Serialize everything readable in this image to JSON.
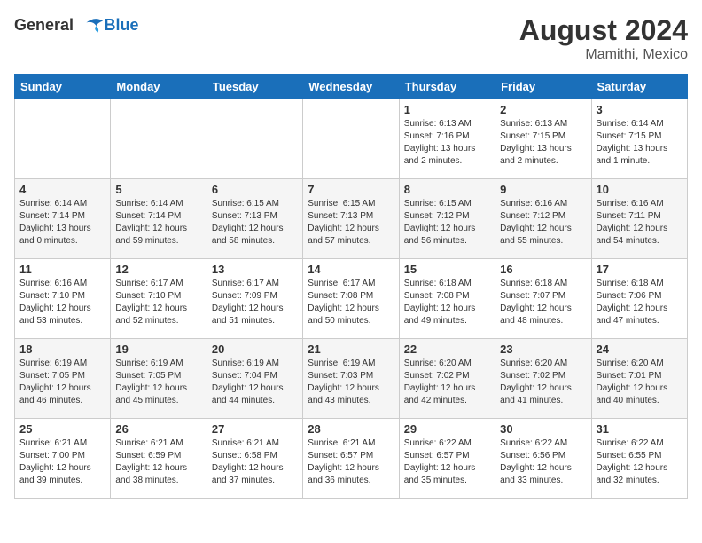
{
  "header": {
    "logo_general": "General",
    "logo_blue": "Blue",
    "month_year": "August 2024",
    "location": "Mamithi, Mexico"
  },
  "days_of_week": [
    "Sunday",
    "Monday",
    "Tuesday",
    "Wednesday",
    "Thursday",
    "Friday",
    "Saturday"
  ],
  "weeks": [
    [
      {
        "day": "",
        "sunrise": "",
        "sunset": "",
        "daylight": ""
      },
      {
        "day": "",
        "sunrise": "",
        "sunset": "",
        "daylight": ""
      },
      {
        "day": "",
        "sunrise": "",
        "sunset": "",
        "daylight": ""
      },
      {
        "day": "",
        "sunrise": "",
        "sunset": "",
        "daylight": ""
      },
      {
        "day": "1",
        "sunrise": "Sunrise: 6:13 AM",
        "sunset": "Sunset: 7:16 PM",
        "daylight": "Daylight: 13 hours and 2 minutes."
      },
      {
        "day": "2",
        "sunrise": "Sunrise: 6:13 AM",
        "sunset": "Sunset: 7:15 PM",
        "daylight": "Daylight: 13 hours and 2 minutes."
      },
      {
        "day": "3",
        "sunrise": "Sunrise: 6:14 AM",
        "sunset": "Sunset: 7:15 PM",
        "daylight": "Daylight: 13 hours and 1 minute."
      }
    ],
    [
      {
        "day": "4",
        "sunrise": "Sunrise: 6:14 AM",
        "sunset": "Sunset: 7:14 PM",
        "daylight": "Daylight: 13 hours and 0 minutes."
      },
      {
        "day": "5",
        "sunrise": "Sunrise: 6:14 AM",
        "sunset": "Sunset: 7:14 PM",
        "daylight": "Daylight: 12 hours and 59 minutes."
      },
      {
        "day": "6",
        "sunrise": "Sunrise: 6:15 AM",
        "sunset": "Sunset: 7:13 PM",
        "daylight": "Daylight: 12 hours and 58 minutes."
      },
      {
        "day": "7",
        "sunrise": "Sunrise: 6:15 AM",
        "sunset": "Sunset: 7:13 PM",
        "daylight": "Daylight: 12 hours and 57 minutes."
      },
      {
        "day": "8",
        "sunrise": "Sunrise: 6:15 AM",
        "sunset": "Sunset: 7:12 PM",
        "daylight": "Daylight: 12 hours and 56 minutes."
      },
      {
        "day": "9",
        "sunrise": "Sunrise: 6:16 AM",
        "sunset": "Sunset: 7:12 PM",
        "daylight": "Daylight: 12 hours and 55 minutes."
      },
      {
        "day": "10",
        "sunrise": "Sunrise: 6:16 AM",
        "sunset": "Sunset: 7:11 PM",
        "daylight": "Daylight: 12 hours and 54 minutes."
      }
    ],
    [
      {
        "day": "11",
        "sunrise": "Sunrise: 6:16 AM",
        "sunset": "Sunset: 7:10 PM",
        "daylight": "Daylight: 12 hours and 53 minutes."
      },
      {
        "day": "12",
        "sunrise": "Sunrise: 6:17 AM",
        "sunset": "Sunset: 7:10 PM",
        "daylight": "Daylight: 12 hours and 52 minutes."
      },
      {
        "day": "13",
        "sunrise": "Sunrise: 6:17 AM",
        "sunset": "Sunset: 7:09 PM",
        "daylight": "Daylight: 12 hours and 51 minutes."
      },
      {
        "day": "14",
        "sunrise": "Sunrise: 6:17 AM",
        "sunset": "Sunset: 7:08 PM",
        "daylight": "Daylight: 12 hours and 50 minutes."
      },
      {
        "day": "15",
        "sunrise": "Sunrise: 6:18 AM",
        "sunset": "Sunset: 7:08 PM",
        "daylight": "Daylight: 12 hours and 49 minutes."
      },
      {
        "day": "16",
        "sunrise": "Sunrise: 6:18 AM",
        "sunset": "Sunset: 7:07 PM",
        "daylight": "Daylight: 12 hours and 48 minutes."
      },
      {
        "day": "17",
        "sunrise": "Sunrise: 6:18 AM",
        "sunset": "Sunset: 7:06 PM",
        "daylight": "Daylight: 12 hours and 47 minutes."
      }
    ],
    [
      {
        "day": "18",
        "sunrise": "Sunrise: 6:19 AM",
        "sunset": "Sunset: 7:05 PM",
        "daylight": "Daylight: 12 hours and 46 minutes."
      },
      {
        "day": "19",
        "sunrise": "Sunrise: 6:19 AM",
        "sunset": "Sunset: 7:05 PM",
        "daylight": "Daylight: 12 hours and 45 minutes."
      },
      {
        "day": "20",
        "sunrise": "Sunrise: 6:19 AM",
        "sunset": "Sunset: 7:04 PM",
        "daylight": "Daylight: 12 hours and 44 minutes."
      },
      {
        "day": "21",
        "sunrise": "Sunrise: 6:19 AM",
        "sunset": "Sunset: 7:03 PM",
        "daylight": "Daylight: 12 hours and 43 minutes."
      },
      {
        "day": "22",
        "sunrise": "Sunrise: 6:20 AM",
        "sunset": "Sunset: 7:02 PM",
        "daylight": "Daylight: 12 hours and 42 minutes."
      },
      {
        "day": "23",
        "sunrise": "Sunrise: 6:20 AM",
        "sunset": "Sunset: 7:02 PM",
        "daylight": "Daylight: 12 hours and 41 minutes."
      },
      {
        "day": "24",
        "sunrise": "Sunrise: 6:20 AM",
        "sunset": "Sunset: 7:01 PM",
        "daylight": "Daylight: 12 hours and 40 minutes."
      }
    ],
    [
      {
        "day": "25",
        "sunrise": "Sunrise: 6:21 AM",
        "sunset": "Sunset: 7:00 PM",
        "daylight": "Daylight: 12 hours and 39 minutes."
      },
      {
        "day": "26",
        "sunrise": "Sunrise: 6:21 AM",
        "sunset": "Sunset: 6:59 PM",
        "daylight": "Daylight: 12 hours and 38 minutes."
      },
      {
        "day": "27",
        "sunrise": "Sunrise: 6:21 AM",
        "sunset": "Sunset: 6:58 PM",
        "daylight": "Daylight: 12 hours and 37 minutes."
      },
      {
        "day": "28",
        "sunrise": "Sunrise: 6:21 AM",
        "sunset": "Sunset: 6:57 PM",
        "daylight": "Daylight: 12 hours and 36 minutes."
      },
      {
        "day": "29",
        "sunrise": "Sunrise: 6:22 AM",
        "sunset": "Sunset: 6:57 PM",
        "daylight": "Daylight: 12 hours and 35 minutes."
      },
      {
        "day": "30",
        "sunrise": "Sunrise: 6:22 AM",
        "sunset": "Sunset: 6:56 PM",
        "daylight": "Daylight: 12 hours and 33 minutes."
      },
      {
        "day": "31",
        "sunrise": "Sunrise: 6:22 AM",
        "sunset": "Sunset: 6:55 PM",
        "daylight": "Daylight: 12 hours and 32 minutes."
      }
    ]
  ]
}
